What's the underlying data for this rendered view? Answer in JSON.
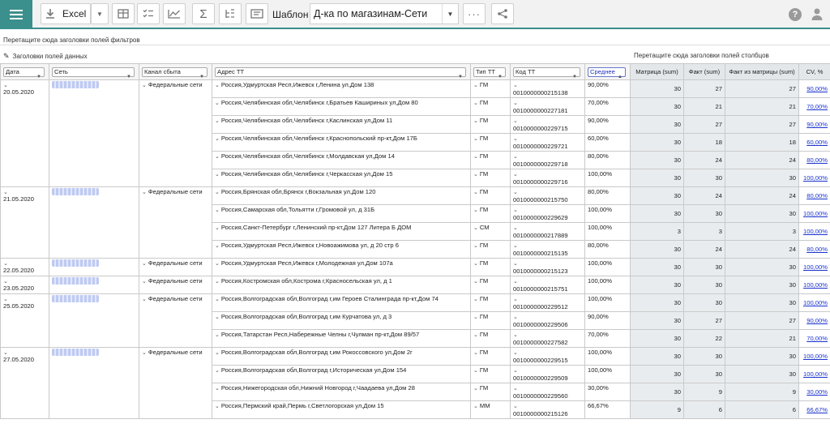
{
  "toolbar": {
    "excel_label": "Excel",
    "template_label": "Шаблон",
    "template_value": "Д-ка по магазинам-Сети"
  },
  "hints": {
    "filters": "Перетащите сюда заголовки полей фильтров",
    "data_fields": "Заголовки полей данных",
    "columns": "Перетащите сюда заголовки полей столбцов"
  },
  "columns": {
    "date": "Дата",
    "chain": "Сеть",
    "channel": "Канал сбыта",
    "address": "Адрес ТТ",
    "type": "Тип ТТ",
    "code": "Код ТТ",
    "avg": "Среднее",
    "matrix": "Матрица (sum)",
    "fact": "Факт (sum)",
    "fact_matrix": "Факт из матрицы (sum)",
    "cv": "CV, %"
  },
  "groups": [
    {
      "date": "20.05.2020",
      "channel": "Федеральные сети",
      "rows": [
        {
          "address": "Россия,Удмуртская Респ,Ижевск г,Ленина ул,Дом 138",
          "type": "ГМ",
          "code": "0010000000215138",
          "avg": "90,00%",
          "matrix": "30",
          "fact": "27",
          "fm": "27",
          "cv": "90,00%"
        },
        {
          "address": "Россия,Челябинская обл,Челябинск г,Братьев Кашириных ул,Дом 80",
          "type": "ГМ",
          "code": "0010000000227181",
          "avg": "70,00%",
          "matrix": "30",
          "fact": "21",
          "fm": "21",
          "cv": "70,00%"
        },
        {
          "address": "Россия,Челябинская обл,Челябинск г,Каслинская ул,Дом 11",
          "type": "ГМ",
          "code": "0010000000229715",
          "avg": "90,00%",
          "matrix": "30",
          "fact": "27",
          "fm": "27",
          "cv": "90,00%"
        },
        {
          "address": "Россия,Челябинская обл,Челябинск г,Краснопольский пр-кт,Дом 17Б",
          "type": "ГМ",
          "code": "0010000000229721",
          "avg": "60,00%",
          "matrix": "30",
          "fact": "18",
          "fm": "18",
          "cv": "60,00%"
        },
        {
          "address": "Россия,Челябинская обл,Челябинск г,Молдавская ул,Дом 14",
          "type": "ГМ",
          "code": "0010000000229718",
          "avg": "80,00%",
          "matrix": "30",
          "fact": "24",
          "fm": "24",
          "cv": "80,00%"
        },
        {
          "address": "Россия,Челябинская обл,Челябинск г,Черкасская ул,Дом 15",
          "type": "ГМ",
          "code": "0010000000229716",
          "avg": "100,00%",
          "matrix": "30",
          "fact": "30",
          "fm": "30",
          "cv": "100,00%"
        }
      ]
    },
    {
      "date": "21.05.2020",
      "channel": "Федеральные сети",
      "rows": [
        {
          "address": "Россия,Брянская обл,Брянск г,Вокзальная ул,Дом 120",
          "type": "ГМ",
          "code": "0010000000215750",
          "avg": "80,00%",
          "matrix": "30",
          "fact": "24",
          "fm": "24",
          "cv": "80,00%"
        },
        {
          "address": "Россия,Самарская обл,Тольятти г,Громовой ул, д 31Б",
          "type": "ГМ",
          "code": "0010000000229629",
          "avg": "100,00%",
          "matrix": "30",
          "fact": "30",
          "fm": "30",
          "cv": "100,00%"
        },
        {
          "address": "Россия,Санкт-Петербург г,Ленинский пр-кт,Дом 127 Литера Б ДОМ",
          "type": "СМ",
          "code": "0010000000217889",
          "avg": "100,00%",
          "matrix": "3",
          "fact": "3",
          "fm": "3",
          "cv": "100,00%"
        },
        {
          "address": "Россия,Удмуртская Респ,Ижевск г,Новоажимова ул, д 20 стр 6",
          "type": "ГМ",
          "code": "0010000000215135",
          "avg": "80,00%",
          "matrix": "30",
          "fact": "24",
          "fm": "24",
          "cv": "80,00%"
        }
      ]
    },
    {
      "date": "22.05.2020",
      "channel": "Федеральные сети",
      "rows": [
        {
          "address": "Россия,Удмуртская Респ,Ижевск г,Молодежная ул,Дом 107а",
          "type": "ГМ",
          "code": "0010000000215123",
          "avg": "100,00%",
          "matrix": "30",
          "fact": "30",
          "fm": "30",
          "cv": "100,00%"
        }
      ]
    },
    {
      "date": "23.05.2020",
      "channel": "Федеральные сети",
      "rows": [
        {
          "address": "Россия,Костромская обл,Кострома г,Красносельская ул, д 1",
          "type": "ГМ",
          "code": "0010000000215751",
          "avg": "100,00%",
          "matrix": "30",
          "fact": "30",
          "fm": "30",
          "cv": "100,00%"
        }
      ]
    },
    {
      "date": "25.05.2020",
      "channel": "Федеральные сети",
      "rows": [
        {
          "address": "Россия,Волгоградская обл,Волгоград г,им Героев Сталинграда пр-кт,Дом 74",
          "type": "ГМ",
          "code": "0010000000229512",
          "avg": "100,00%",
          "matrix": "30",
          "fact": "30",
          "fm": "30",
          "cv": "100,00%"
        },
        {
          "address": "Россия,Волгоградская обл,Волгоград г,им Курчатова ул, д 3",
          "type": "ГМ",
          "code": "0010000000229506",
          "avg": "90,00%",
          "matrix": "30",
          "fact": "27",
          "fm": "27",
          "cv": "90,00%"
        },
        {
          "address": "Россия,Татарстан Респ,Набережные Челны г,Чулман пр-кт,Дом 89/57",
          "type": "ГМ",
          "code": "0010000000227582",
          "avg": "70,00%",
          "matrix": "30",
          "fact": "22",
          "fm": "21",
          "cv": "70,00%"
        }
      ]
    },
    {
      "date": "27.05.2020",
      "channel": "Федеральные сети",
      "rows": [
        {
          "address": "Россия,Волгоградская обл,Волгоград г,им Рокоссовского ул,Дом 2г",
          "type": "ГМ",
          "code": "0010000000229515",
          "avg": "100,00%",
          "matrix": "30",
          "fact": "30",
          "fm": "30",
          "cv": "100,00%"
        },
        {
          "address": "Россия,Волгоградская обл,Волгоград г,Историческая ул,Дом 154",
          "type": "ГМ",
          "code": "0010000000229509",
          "avg": "100,00%",
          "matrix": "30",
          "fact": "30",
          "fm": "30",
          "cv": "100,00%"
        },
        {
          "address": "Россия,Нижегородская обл,Нижний Новгород г,Чаадаева ул,Дом 28",
          "type": "ГМ",
          "code": "0010000000229560",
          "avg": "30,00%",
          "matrix": "30",
          "fact": "9",
          "fm": "9",
          "cv": "30,00%"
        },
        {
          "address": "Россия,Пермский край,Пермь г,Светлогорская ул,Дом 15",
          "type": "ММ",
          "code": "0010000000215126",
          "avg": "66,67%",
          "matrix": "9",
          "fact": "6",
          "fm": "6",
          "cv": "66,67%"
        }
      ]
    }
  ]
}
